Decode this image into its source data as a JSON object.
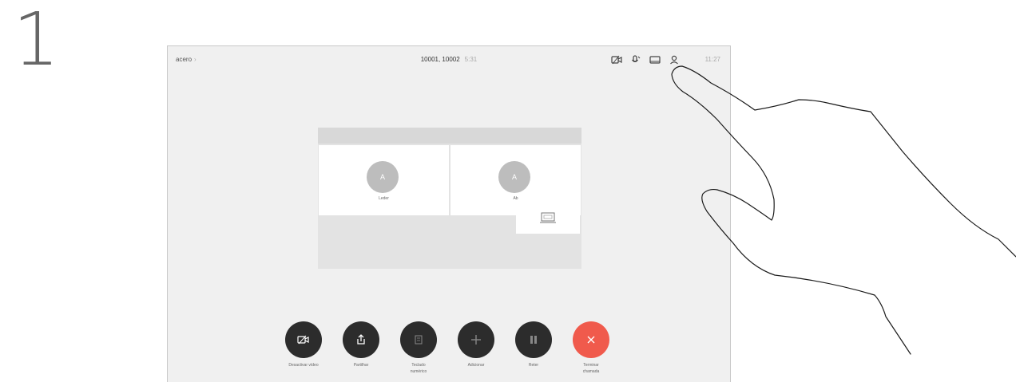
{
  "step": {
    "number": "1"
  },
  "topbar": {
    "left_label": "acero",
    "left_chevron": "›",
    "call_title": "10001, 10002",
    "call_timer": "5:31",
    "clock": "11:27",
    "icons": [
      "camera-icon",
      "microphone-icon",
      "screen-icon",
      "participants-icon"
    ]
  },
  "participants": [
    {
      "name": "Leder",
      "avatar": "A"
    },
    {
      "name": "Ab",
      "avatar": "A"
    }
  ],
  "controls": [
    {
      "label": "Desactivar vídeo",
      "icon": "video-off-icon",
      "style": "dark"
    },
    {
      "label": "Partilhar",
      "icon": "share-icon",
      "style": "dark"
    },
    {
      "label": "Teclado\nnumérico",
      "icon": "keypad-icon",
      "style": "dark"
    },
    {
      "label": "Adicionar",
      "icon": "plus-icon",
      "style": "dark"
    },
    {
      "label": "Reter",
      "icon": "hold-icon",
      "style": "dark"
    },
    {
      "label": "Terminar\nchamada",
      "icon": "end-call-icon",
      "style": "red"
    }
  ],
  "colors": {
    "end_call": "#f05a4c",
    "button": "#2c2c2c",
    "avatar": "#bdbdbd"
  }
}
